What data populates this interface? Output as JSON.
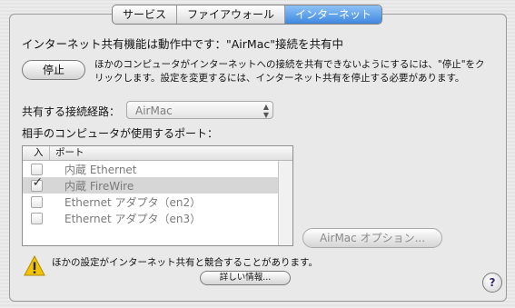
{
  "tabs": [
    {
      "label": "サービス",
      "active": false
    },
    {
      "label": "ファイアウォール",
      "active": false
    },
    {
      "label": "インターネット",
      "active": true
    }
  ],
  "status_text": "インターネット共有機能は動作中です：\"AirMac\"接続を共有中",
  "stop_button": "停止",
  "stop_description": "ほかのコンピュータがインターネットへの接続を共有できないようにするには、\"停止\"をクリックします。設定を変更するには、インターネット共有を停止する必要があります。",
  "route": {
    "label": "共有する接続経路：",
    "value": "AirMac"
  },
  "ports": {
    "label": "相手のコンピュータが使用するポート：",
    "columns": {
      "in": "入",
      "port": "ポート"
    },
    "rows": [
      {
        "name": "内蔵 Ethernet",
        "checked": false,
        "selected": false
      },
      {
        "name": "内蔵 FireWire",
        "checked": true,
        "selected": true
      },
      {
        "name": "Ethernet アダプタ（en2）",
        "checked": false,
        "selected": false
      },
      {
        "name": "Ethernet アダプタ（en3）",
        "checked": false,
        "selected": false
      }
    ]
  },
  "airmac_options_button": "AirMac オプション...",
  "warning": {
    "text": "ほかの設定がインターネット共有と競合することがあります。",
    "icon": "warning-triangle-icon"
  },
  "details_button": "詳しい情報...",
  "help_button": "?",
  "colors": {
    "accent": "#3f88e0",
    "warning": "#f3c400"
  }
}
